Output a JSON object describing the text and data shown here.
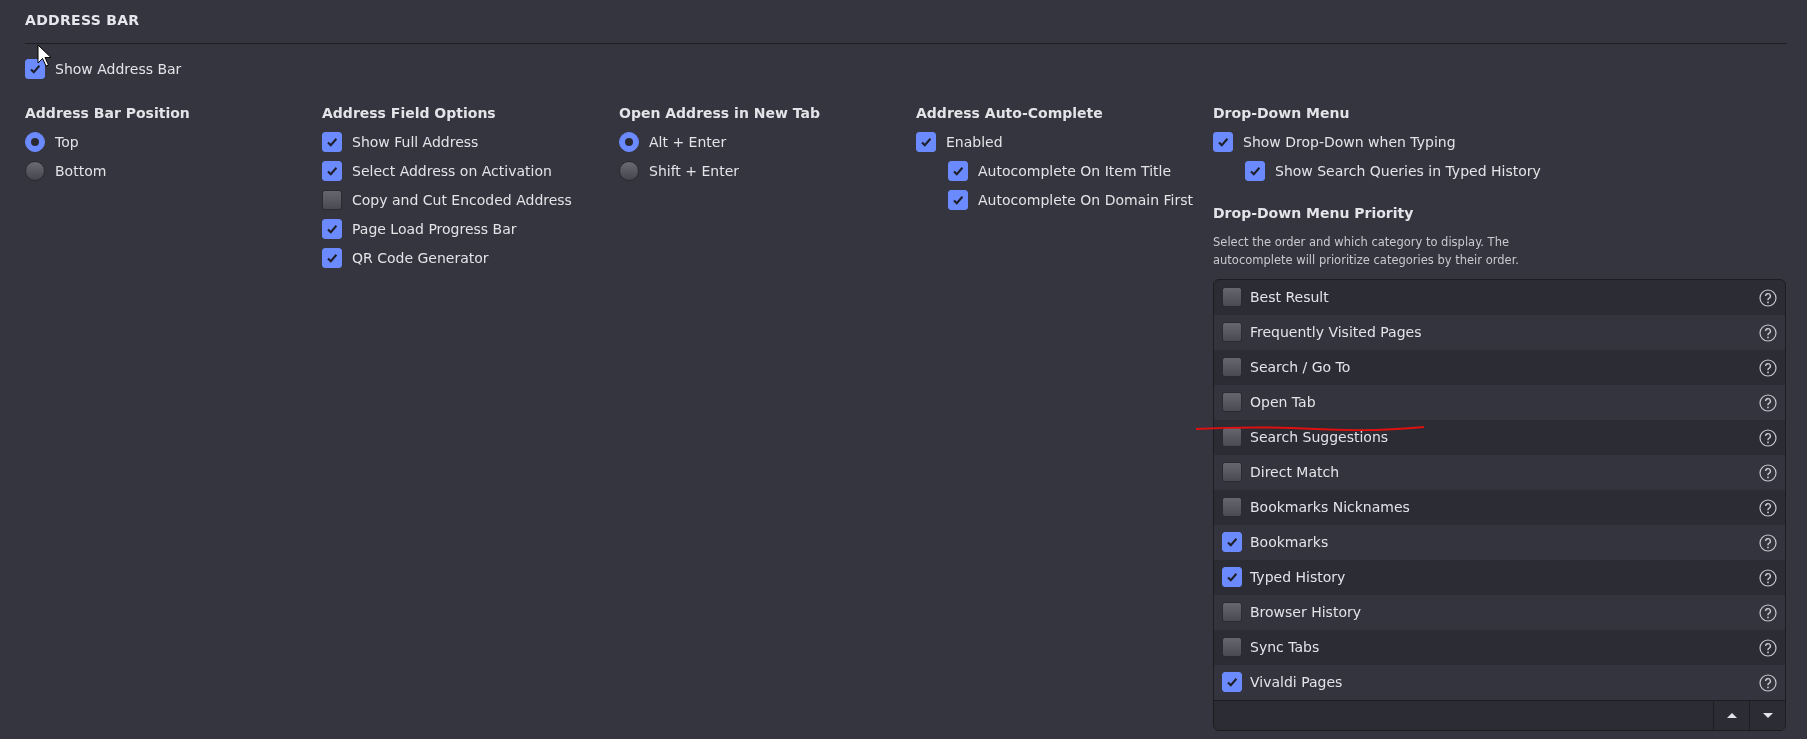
{
  "section_title": "ADDRESS BAR",
  "show_address_bar": {
    "label": "Show Address Bar",
    "checked": true
  },
  "groups": [
    {
      "heading": "Address Bar Position",
      "options": [
        {
          "kind": "radio",
          "label": "Top",
          "selected": true
        },
        {
          "kind": "radio",
          "label": "Bottom",
          "selected": false
        }
      ]
    },
    {
      "heading": "Address Field Options",
      "options": [
        {
          "kind": "checkbox",
          "label": "Show Full Address",
          "checked": true
        },
        {
          "kind": "checkbox",
          "label": "Select Address on Activation",
          "checked": true
        },
        {
          "kind": "checkbox",
          "label": "Copy and Cut Encoded Address",
          "checked": false
        },
        {
          "kind": "checkbox",
          "label": "Page Load Progress Bar",
          "checked": true
        },
        {
          "kind": "checkbox",
          "label": "QR Code Generator",
          "checked": true
        }
      ]
    },
    {
      "heading": "Open Address in New Tab",
      "options": [
        {
          "kind": "radio",
          "label": "Alt + Enter",
          "selected": true
        },
        {
          "kind": "radio",
          "label": "Shift + Enter",
          "selected": false
        }
      ]
    },
    {
      "heading": "Address Auto-Complete",
      "options": [
        {
          "kind": "checkbox",
          "label": "Enabled",
          "checked": true,
          "children": [
            {
              "kind": "checkbox",
              "label": "Autocomplete On Item Title",
              "checked": true
            },
            {
              "kind": "checkbox",
              "label": "Autocomplete On Domain First",
              "checked": true
            }
          ]
        }
      ]
    },
    {
      "heading": "Drop-Down Menu",
      "options": [
        {
          "kind": "checkbox",
          "label": "Show Drop-Down when Typing",
          "checked": true,
          "children": [
            {
              "kind": "checkbox",
              "label": "Show Search Queries in Typed History",
              "checked": true
            }
          ]
        }
      ],
      "priority": {
        "heading": "Drop-Down Menu Priority",
        "description": "Select the order and which category to display. The autocomplete will prioritize categories by their order.",
        "items": [
          {
            "label": "Best Result",
            "checked": false
          },
          {
            "label": "Frequently Visited Pages",
            "checked": false
          },
          {
            "label": "Search / Go To",
            "checked": false
          },
          {
            "label": "Open Tab",
            "checked": false
          },
          {
            "label": "Search Suggestions",
            "checked": false
          },
          {
            "label": "Direct Match",
            "checked": false
          },
          {
            "label": "Bookmarks Nicknames",
            "checked": false
          },
          {
            "label": "Bookmarks",
            "checked": true
          },
          {
            "label": "Typed History",
            "checked": true
          },
          {
            "label": "Browser History",
            "checked": false
          },
          {
            "label": "Sync Tabs",
            "checked": false
          },
          {
            "label": "Vivaldi Pages",
            "checked": true
          }
        ]
      }
    }
  ]
}
